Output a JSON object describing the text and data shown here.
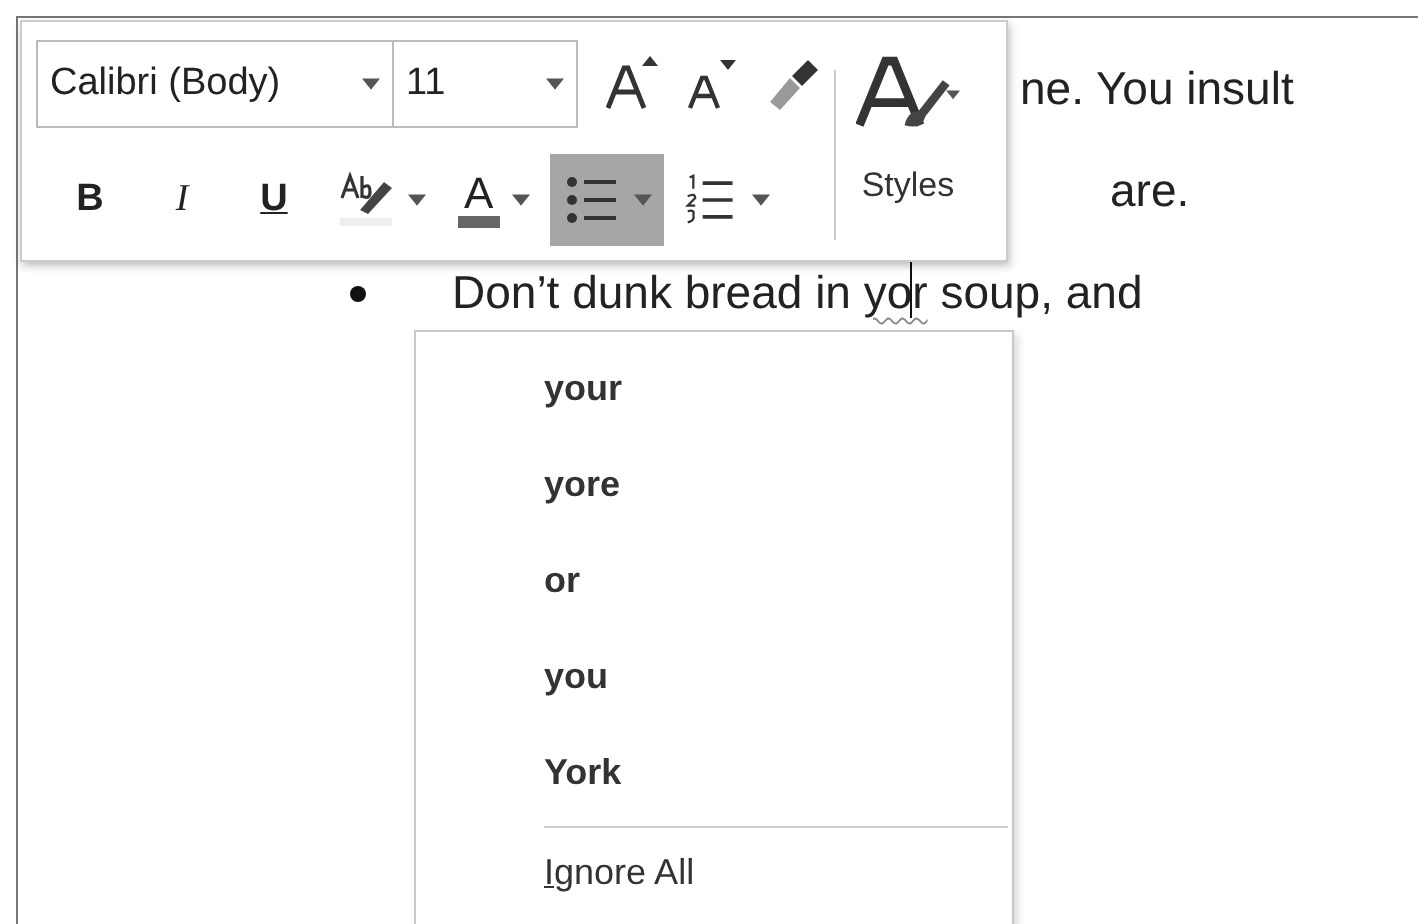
{
  "document": {
    "lines": [
      {
        "kind": "plain",
        "text": "ne. You insult"
      },
      {
        "kind": "plain",
        "text": "are."
      },
      {
        "kind": "bullet",
        "before": "Don’t dunk bread in ",
        "misspelled": "yor",
        "after": " soup, and"
      }
    ]
  },
  "mini_toolbar": {
    "font": {
      "value": "Calibri (Body)"
    },
    "size": {
      "value": "11"
    },
    "format_buttons": [
      {
        "kind": "bold",
        "label": "B",
        "selected": false
      },
      {
        "kind": "italic",
        "label": "I",
        "selected": false
      },
      {
        "kind": "underline",
        "label": "U",
        "selected": false
      },
      {
        "kind": "highlight",
        "selected": false
      },
      {
        "kind": "font-color",
        "label": "A",
        "selected": false
      },
      {
        "kind": "bullets",
        "selected": true
      },
      {
        "kind": "numbering",
        "selected": false
      }
    ],
    "styles_label": "Styles"
  },
  "context_menu": {
    "suggestions": [
      "your",
      "yore",
      "or",
      "you",
      "York"
    ],
    "actions": [
      "Ignore All"
    ]
  }
}
